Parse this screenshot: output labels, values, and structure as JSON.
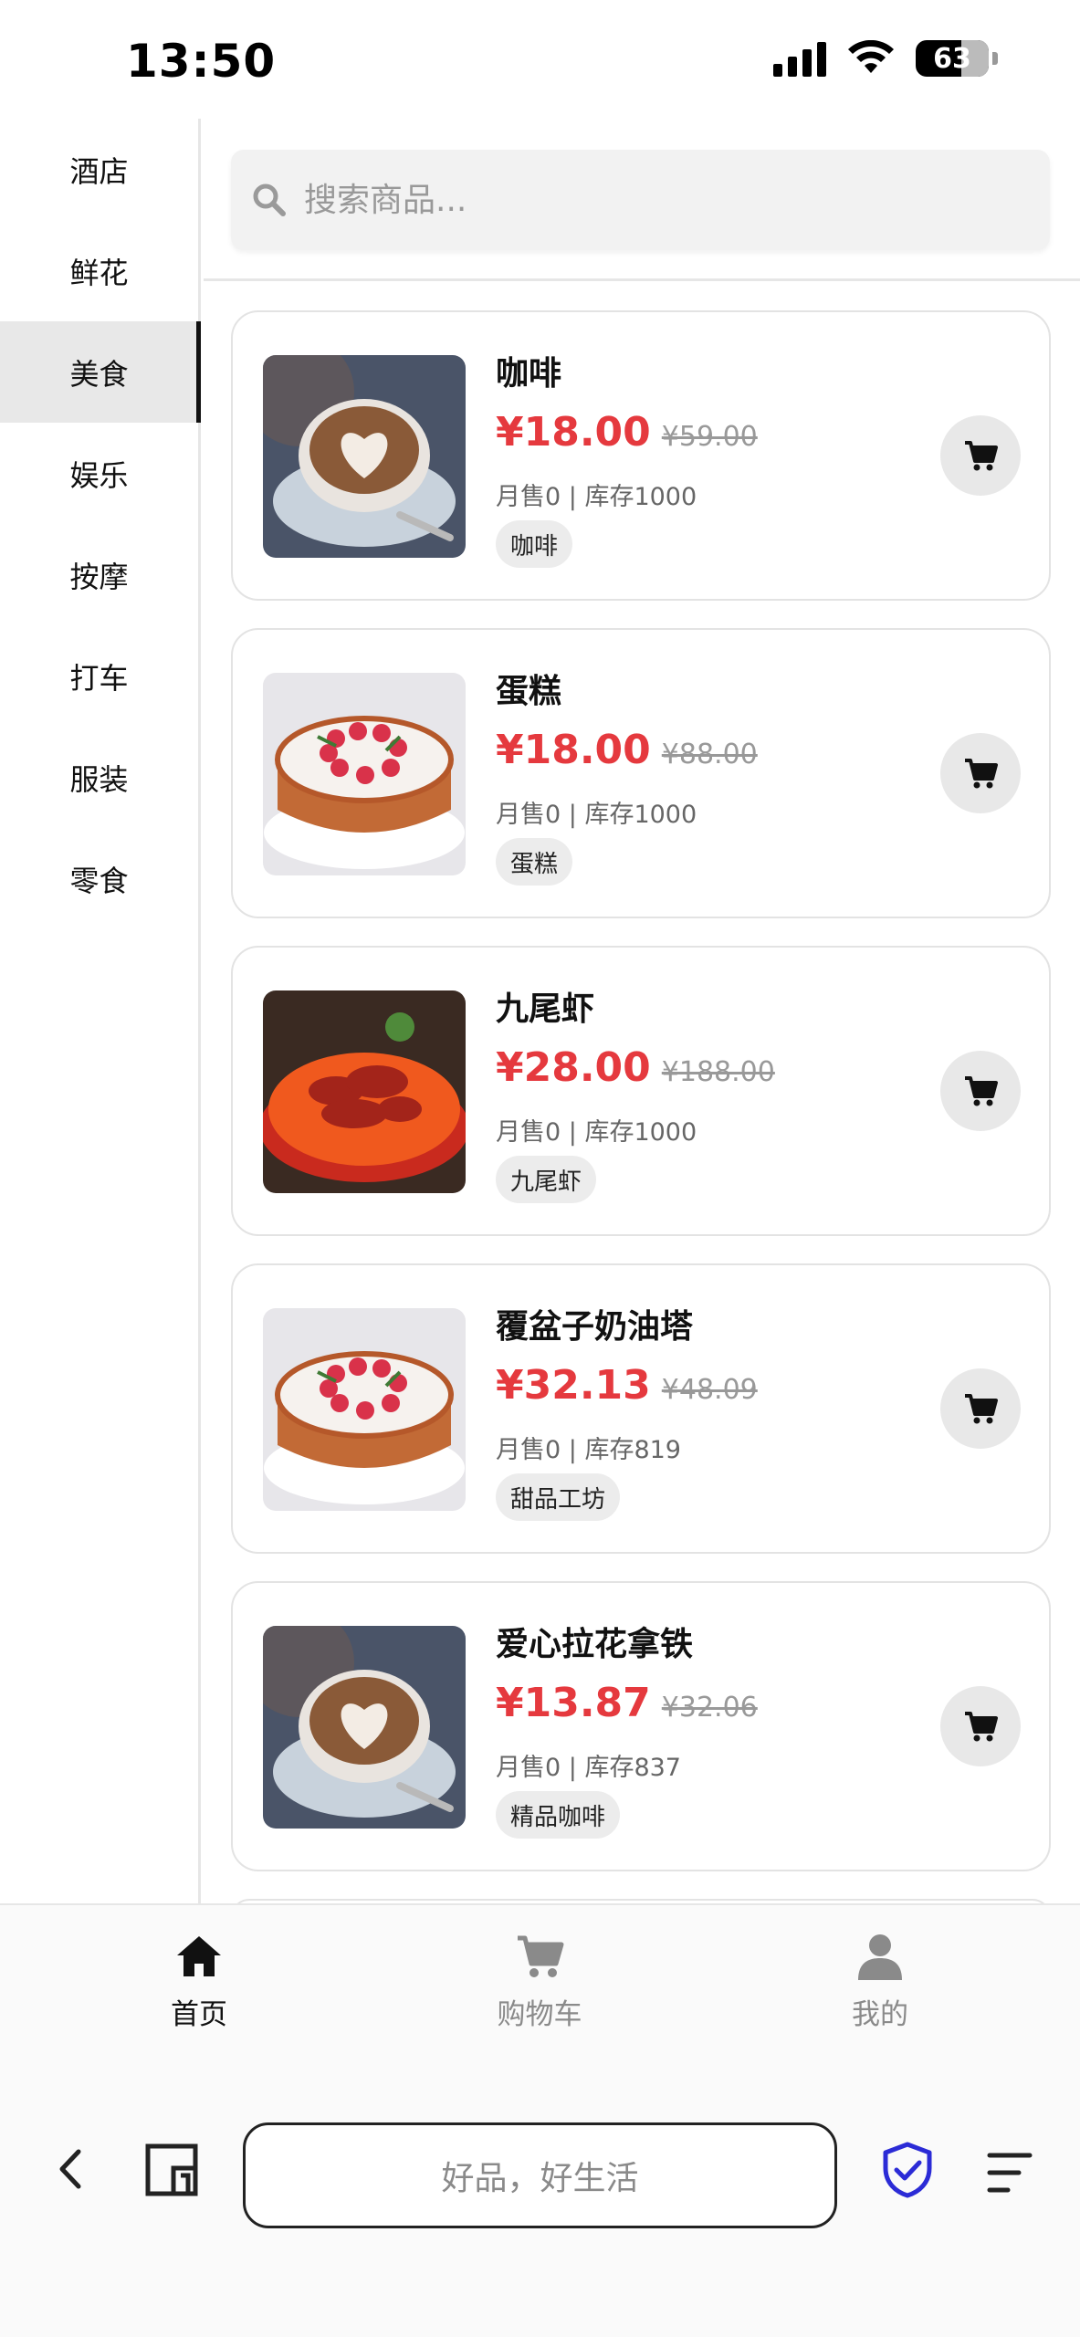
{
  "status_bar": {
    "time": "13:50",
    "battery": "63",
    "battery_level": 0.63,
    "icons": [
      "signal-icon",
      "wifi-icon",
      "battery-icon"
    ]
  },
  "sidebar": {
    "items": [
      {
        "label": "酒店"
      },
      {
        "label": "鲜花"
      },
      {
        "label": "美食",
        "active": true
      },
      {
        "label": "娱乐"
      },
      {
        "label": "按摩"
      },
      {
        "label": "打车"
      },
      {
        "label": "服装"
      },
      {
        "label": "零食"
      }
    ]
  },
  "search": {
    "placeholder": "搜索商品..."
  },
  "products": [
    {
      "name": "咖啡",
      "price": "¥18.00",
      "original_price": "¥59.00",
      "stats": "月售0 | 库存1000",
      "tag": "咖啡",
      "image": "coffee"
    },
    {
      "name": "蛋糕",
      "price": "¥18.00",
      "original_price": "¥88.00",
      "stats": "月售0 | 库存1000",
      "tag": "蛋糕",
      "image": "cake"
    },
    {
      "name": "九尾虾",
      "price": "¥28.00",
      "original_price": "¥188.00",
      "stats": "月售0 | 库存1000",
      "tag": "九尾虾",
      "image": "crayfish"
    },
    {
      "name": "覆盆子奶油塔",
      "price": "¥32.13",
      "original_price": "¥48.09",
      "stats": "月售0 | 库存819",
      "tag": "甜品工坊",
      "image": "cake"
    },
    {
      "name": "爱心拉花拿铁",
      "price": "¥13.87",
      "original_price": "¥32.06",
      "stats": "月售0 | 库存837",
      "tag": "精品咖啡",
      "image": "coffee"
    }
  ],
  "tabbar": {
    "home": "首页",
    "cart": "购物车",
    "mine": "我的"
  },
  "browser": {
    "url_text": "好品，好生活"
  },
  "colors": {
    "price_red": "#e5393e",
    "active_tab": "#111111",
    "inactive_tab": "#8a8a8a",
    "shield_blue": "#2b2bd6"
  }
}
